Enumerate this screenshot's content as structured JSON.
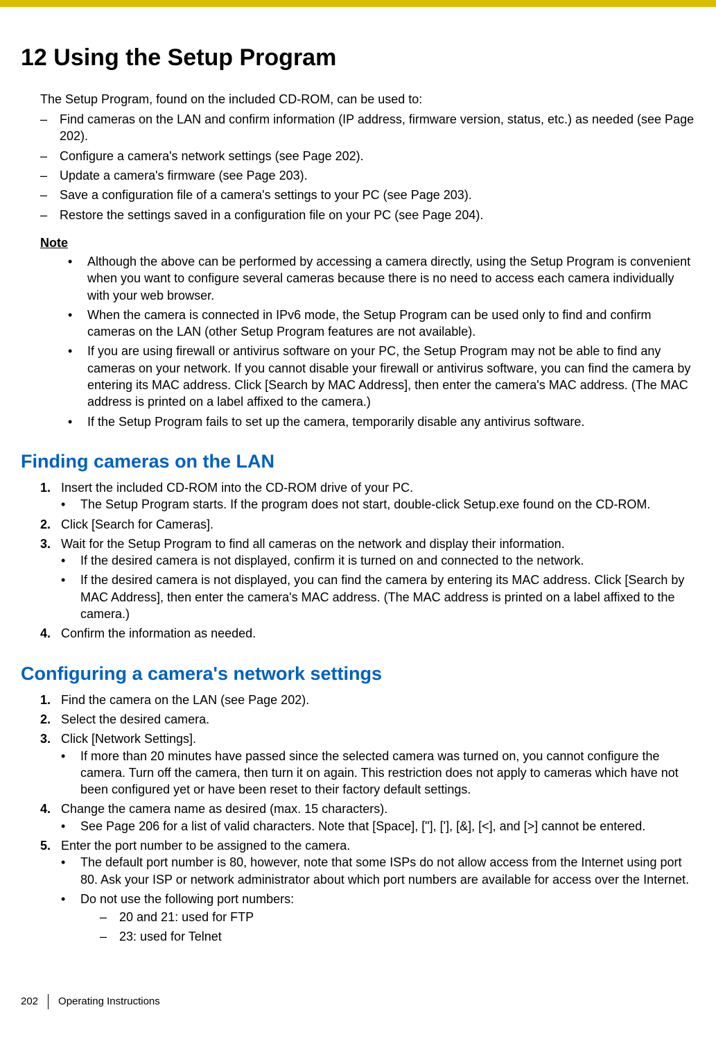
{
  "heading": "12   Using the Setup Program",
  "intro_lead": "The Setup Program, found on the included CD-ROM, can be used to:",
  "intro_items": [
    "Find cameras on the LAN and confirm information (IP address, firmware version, status, etc.) as needed (see Page 202).",
    "Configure a camera's network settings (see Page 202).",
    "Update a camera's firmware (see Page 203).",
    "Save a configuration file of a camera's settings to your PC (see Page 203).",
    "Restore the settings saved in a configuration file on your PC (see Page 204)."
  ],
  "note_label": "Note",
  "note_items": [
    "Although the above can be performed by accessing a camera directly, using the Setup Program is convenient when you want to configure several cameras because there is no need to access each camera individually with your web browser.",
    "When the camera is connected in IPv6 mode, the Setup Program can be used only to find and confirm cameras on the LAN (other Setup Program features are not available).",
    "If you are using firewall or antivirus software on your PC, the Setup Program may not be able to find any cameras on your network. If you cannot disable your firewall or antivirus software, you can find the camera by entering its MAC address. Click [Search by MAC Address], then enter the camera's MAC address. (The MAC address is printed on a label affixed to the camera.)",
    "If the Setup Program fails to set up the camera, temporarily disable any antivirus software."
  ],
  "section1_title": "Finding cameras on the LAN",
  "section1_steps": {
    "s1": "Insert the included CD-ROM into the CD-ROM drive of your PC.",
    "s1_sub": [
      "The Setup Program starts. If the program does not start, double-click Setup.exe found on the CD-ROM."
    ],
    "s2": "Click [Search for Cameras].",
    "s3": "Wait for the Setup Program to find all cameras on the network and display their information.",
    "s3_sub": [
      "If the desired camera is not displayed, confirm it is turned on and connected to the network.",
      "If the desired camera is not displayed, you can find the camera by entering its MAC address. Click [Search by MAC Address], then enter the camera's MAC address. (The MAC address is printed on a label affixed to the camera.)"
    ],
    "s4": "Confirm the information as needed."
  },
  "section2_title": "Configuring a camera's network settings",
  "section2_steps": {
    "s1": "Find the camera on the LAN (see Page 202).",
    "s2": "Select the desired camera.",
    "s3": "Click [Network Settings].",
    "s3_sub": [
      "If more than 20 minutes have passed since the selected camera was turned on, you cannot configure the camera. Turn off the camera, then turn it on again. This restriction does not apply to cameras which have not been configured yet or have been reset to their factory default settings."
    ],
    "s4": "Change the camera name as desired (max. 15 characters).",
    "s4_sub": [
      "See Page 206 for a list of valid characters. Note that [Space], [\"], ['], [&], [<], and [>] cannot be entered."
    ],
    "s5": "Enter the port number to be assigned to the camera.",
    "s5_sub": [
      "The default port number is 80, however, note that some ISPs do not allow access from the Internet using port 80. Ask your ISP or network administrator about which port numbers are available for access over the Internet.",
      "Do not use the following port numbers:"
    ],
    "s5_dash": [
      "20 and 21: used for FTP",
      "23: used for Telnet"
    ]
  },
  "footer_page": "202",
  "footer_doc": "Operating Instructions"
}
